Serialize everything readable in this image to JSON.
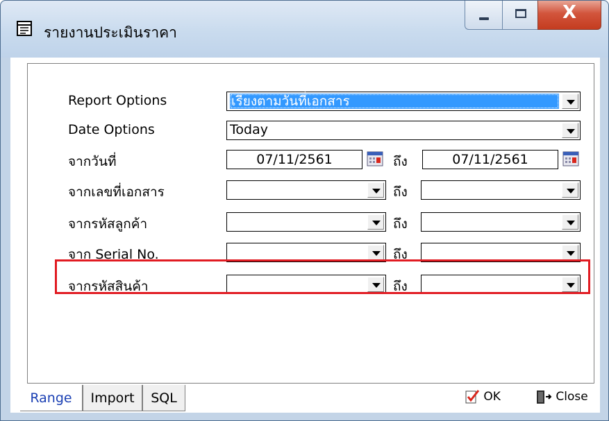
{
  "window": {
    "title": "รายงานประเมินราคา",
    "close_glyph": "X"
  },
  "form": {
    "report_options": {
      "label": "Report Options",
      "value": "เรียงตามวันที่เอกสาร"
    },
    "date_options": {
      "label": "Date Options",
      "value": "Today"
    },
    "from_date": {
      "label": "จากวันที่",
      "from": "07/11/2561",
      "to_label": "ถึง",
      "to": "07/11/2561"
    },
    "doc_no": {
      "label": "จากเลขที่เอกสาร",
      "to_label": "ถึง",
      "from": "",
      "to": ""
    },
    "customer": {
      "label": "จากรหัสลูกค้า",
      "to_label": "ถึง",
      "from": "",
      "to": ""
    },
    "serial": {
      "label": "จาก Serial No.",
      "to_label": "ถึง",
      "from": "",
      "to": ""
    },
    "product": {
      "label": "จากรหัสสินค้า",
      "to_label": "ถึง",
      "from": "",
      "to": ""
    }
  },
  "tabs": [
    {
      "label": "Range",
      "active": true
    },
    {
      "label": "Import",
      "active": false
    },
    {
      "label": "SQL",
      "active": false
    }
  ],
  "footer": {
    "ok_label": "OK",
    "close_label": "Close"
  },
  "colors": {
    "highlight": "#e11b22",
    "selection": "#3399ff",
    "active_tab_text": "#1a3fb3"
  },
  "icons": [
    "report-icon",
    "minimize-icon",
    "maximize-icon",
    "close-icon",
    "dropdown-arrow-icon",
    "calendar-icon",
    "ok-check-icon",
    "exit-door-icon"
  ]
}
